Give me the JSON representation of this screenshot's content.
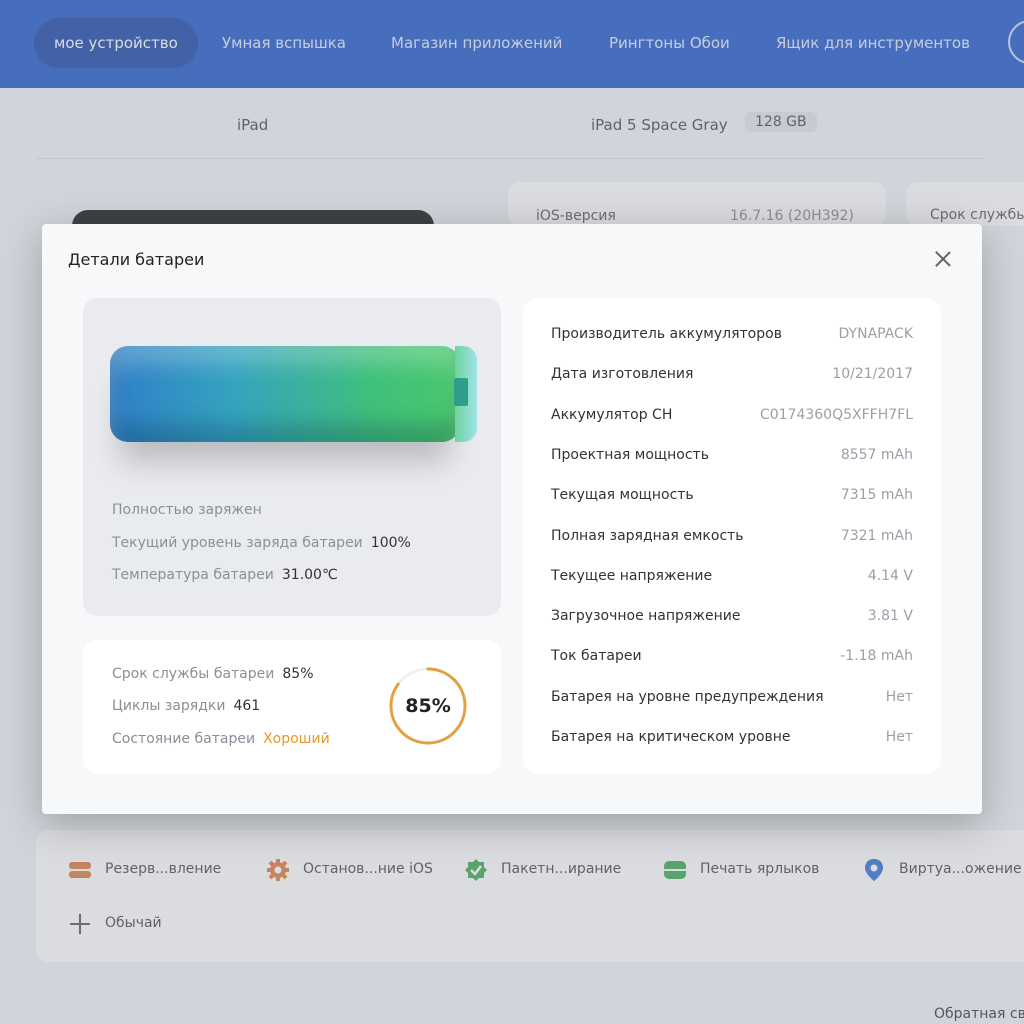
{
  "nav": {
    "items": [
      "мое устройство",
      "Умная вспышка",
      "Магазин приложений",
      "Рингтоны Обои",
      "Ящик для инструментов"
    ]
  },
  "device": {
    "type": "iPad",
    "model": "iPad 5 Space Gray",
    "storage": "128 GB"
  },
  "background": {
    "ios_label": "iOS-версия",
    "ios_value": "16.7.16 (20H392)",
    "life_label": "Срок службы"
  },
  "modal": {
    "title": "Детали батареи",
    "status": "Полностью заряжен",
    "charge_label": "Текущий уровень заряда батареи",
    "charge_value": "100%",
    "temp_label": "Температура батареи",
    "temp_value": "31.00℃",
    "life_label": "Срок службы батареи",
    "life_value": "85%",
    "cycles_label": "Циклы зарядки",
    "cycles_value": "461",
    "state_label": "Состояние батареи",
    "state_value": "Хороший",
    "ring_text": "85%",
    "ring_fraction": 0.85,
    "details": [
      {
        "label": "Производитель аккумуляторов",
        "value": "DYNAPACK"
      },
      {
        "label": "Дата изготовления",
        "value": "10/21/2017"
      },
      {
        "label": "Аккумулятор СН",
        "value": "C0174360Q5XFFH7FL"
      },
      {
        "label": "Проектная мощность",
        "value": "8557 mAh"
      },
      {
        "label": "Текущая мощность",
        "value": "7315 mAh"
      },
      {
        "label": "Полная зарядная емкость",
        "value": "7321 mAh"
      },
      {
        "label": "Текущее напряжение",
        "value": "4.14 V"
      },
      {
        "label": "Загрузочное напряжение",
        "value": "3.81 V"
      },
      {
        "label": "Ток батареи",
        "value": "-1.18 mAh"
      },
      {
        "label": "Батарея на уровне предупреждения",
        "value": "Нет"
      },
      {
        "label": "Батарея на критическом уровне",
        "value": "Нет"
      }
    ]
  },
  "toolbar": {
    "backup": "Резерв...вление",
    "stop_ios": "Останов...ние iOS",
    "batch": "Пакетн...ирание",
    "labels": "Печать ярлыков",
    "virtual": "Виртуа...ожение",
    "custom": "Обычай"
  },
  "footer": {
    "feedback": "Обратная св"
  },
  "colors": {
    "nav_bg": "#1e56c9",
    "good_state": "#e39a2b",
    "ring": "#e3a043"
  }
}
